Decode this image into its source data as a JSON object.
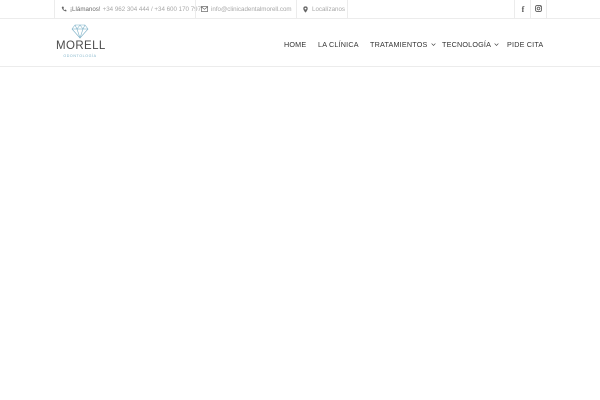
{
  "topbar": {
    "phone_label": "¡Llámanos!",
    "phone_numbers": "+34 962 304 444 / +34 600 170 797",
    "email": "info@clinicadentalmorell.com",
    "location": "Localízanos",
    "social": {
      "facebook": "f",
      "instagram": "instagram-icon"
    }
  },
  "brand": {
    "name": "MORELL",
    "tagline": "ODONTOLOGÍA",
    "accent_color": "#7fb3c9"
  },
  "nav": {
    "items": [
      {
        "label": "HOME"
      },
      {
        "label": "LA CLÍNICA"
      },
      {
        "label": "TRATAMIENTOS"
      },
      {
        "label": "TECNOLOGÍA"
      },
      {
        "label": "PIDE CITA"
      }
    ]
  }
}
